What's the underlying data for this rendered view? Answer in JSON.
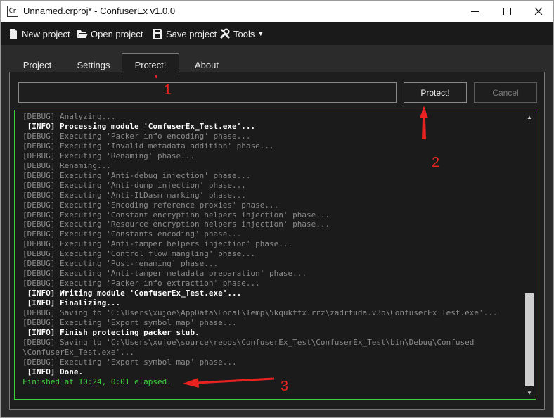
{
  "window": {
    "title": "Unnamed.crproj* - ConfuserEx v1.0.0",
    "icon_text": "Cr",
    "controls": [
      "minimize-icon",
      "maximize-icon",
      "close-icon"
    ]
  },
  "toolbar": {
    "new_project": "New project",
    "open_project": "Open project",
    "save_project": "Save project",
    "tools": "Tools"
  },
  "tabs": [
    {
      "label": "Project"
    },
    {
      "label": "Settings"
    },
    {
      "label": "Protect!"
    },
    {
      "label": "About"
    }
  ],
  "protect": {
    "path_value": "",
    "protect_label": "Protect!",
    "cancel_label": "Cancel"
  },
  "log": {
    "lines": [
      {
        "level": "debug",
        "text": "[DEBUG] Analyzing..."
      },
      {
        "level": "info",
        "text": " [INFO] Processing module 'ConfuserEx_Test.exe'..."
      },
      {
        "level": "debug",
        "text": "[DEBUG] Executing 'Packer info encoding' phase..."
      },
      {
        "level": "debug",
        "text": "[DEBUG] Executing 'Invalid metadata addition' phase..."
      },
      {
        "level": "debug",
        "text": "[DEBUG] Executing 'Renaming' phase..."
      },
      {
        "level": "debug",
        "text": "[DEBUG] Renaming..."
      },
      {
        "level": "debug",
        "text": "[DEBUG] Executing 'Anti-debug injection' phase..."
      },
      {
        "level": "debug",
        "text": "[DEBUG] Executing 'Anti-dump injection' phase..."
      },
      {
        "level": "debug",
        "text": "[DEBUG] Executing 'Anti-ILDasm marking' phase..."
      },
      {
        "level": "debug",
        "text": "[DEBUG] Executing 'Encoding reference proxies' phase..."
      },
      {
        "level": "debug",
        "text": "[DEBUG] Executing 'Constant encryption helpers injection' phase..."
      },
      {
        "level": "debug",
        "text": "[DEBUG] Executing 'Resource encryption helpers injection' phase..."
      },
      {
        "level": "debug",
        "text": "[DEBUG] Executing 'Constants encoding' phase..."
      },
      {
        "level": "debug",
        "text": "[DEBUG] Executing 'Anti-tamper helpers injection' phase..."
      },
      {
        "level": "debug",
        "text": "[DEBUG] Executing 'Control flow mangling' phase..."
      },
      {
        "level": "debug",
        "text": "[DEBUG] Executing 'Post-renaming' phase..."
      },
      {
        "level": "debug",
        "text": "[DEBUG] Executing 'Anti-tamper metadata preparation' phase..."
      },
      {
        "level": "debug",
        "text": "[DEBUG] Executing 'Packer info extraction' phase..."
      },
      {
        "level": "info",
        "text": " [INFO] Writing module 'ConfuserEx_Test.exe'..."
      },
      {
        "level": "info",
        "text": " [INFO] Finalizing..."
      },
      {
        "level": "debug",
        "text": "[DEBUG] Saving to 'C:\\Users\\xujoe\\AppData\\Local\\Temp\\5kquktfx.rrz\\zadrtuda.v3b\\ConfuserEx_Test.exe'..."
      },
      {
        "level": "debug",
        "text": "[DEBUG] Executing 'Export symbol map' phase..."
      },
      {
        "level": "info",
        "text": " [INFO] Finish protecting packer stub."
      },
      {
        "level": "debug",
        "text": "[DEBUG] Saving to 'C:\\Users\\xujoe\\source\\repos\\ConfuserEx_Test\\ConfuserEx_Test\\bin\\Debug\\Confused"
      },
      {
        "level": "debug",
        "text": "\\ConfuserEx_Test.exe'..."
      },
      {
        "level": "debug",
        "text": "[DEBUG] Executing 'Export symbol map' phase..."
      },
      {
        "level": "info",
        "text": " [INFO] Done."
      },
      {
        "level": "finish",
        "text": "Finished at 10:24, 0:01 elapsed."
      }
    ]
  },
  "annotations": {
    "label_1": "1",
    "label_2": "2",
    "label_3": "3",
    "color": "#e8231f"
  }
}
